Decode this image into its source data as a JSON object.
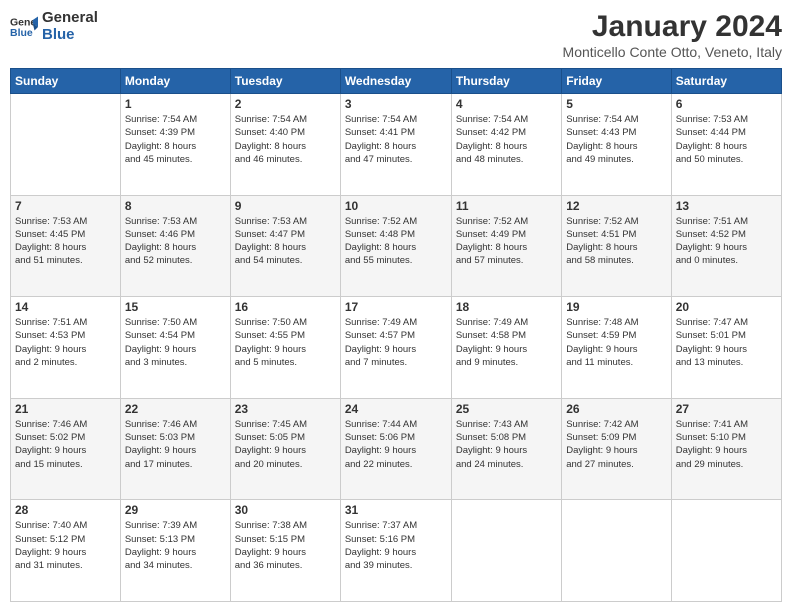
{
  "logo": {
    "line1": "General",
    "line2": "Blue"
  },
  "title": "January 2024",
  "subtitle": "Monticello Conte Otto, Veneto, Italy",
  "days_header": [
    "Sunday",
    "Monday",
    "Tuesday",
    "Wednesday",
    "Thursday",
    "Friday",
    "Saturday"
  ],
  "weeks": [
    [
      {
        "day": "",
        "info": ""
      },
      {
        "day": "1",
        "info": "Sunrise: 7:54 AM\nSunset: 4:39 PM\nDaylight: 8 hours\nand 45 minutes."
      },
      {
        "day": "2",
        "info": "Sunrise: 7:54 AM\nSunset: 4:40 PM\nDaylight: 8 hours\nand 46 minutes."
      },
      {
        "day": "3",
        "info": "Sunrise: 7:54 AM\nSunset: 4:41 PM\nDaylight: 8 hours\nand 47 minutes."
      },
      {
        "day": "4",
        "info": "Sunrise: 7:54 AM\nSunset: 4:42 PM\nDaylight: 8 hours\nand 48 minutes."
      },
      {
        "day": "5",
        "info": "Sunrise: 7:54 AM\nSunset: 4:43 PM\nDaylight: 8 hours\nand 49 minutes."
      },
      {
        "day": "6",
        "info": "Sunrise: 7:53 AM\nSunset: 4:44 PM\nDaylight: 8 hours\nand 50 minutes."
      }
    ],
    [
      {
        "day": "7",
        "info": "Sunrise: 7:53 AM\nSunset: 4:45 PM\nDaylight: 8 hours\nand 51 minutes."
      },
      {
        "day": "8",
        "info": "Sunrise: 7:53 AM\nSunset: 4:46 PM\nDaylight: 8 hours\nand 52 minutes."
      },
      {
        "day": "9",
        "info": "Sunrise: 7:53 AM\nSunset: 4:47 PM\nDaylight: 8 hours\nand 54 minutes."
      },
      {
        "day": "10",
        "info": "Sunrise: 7:52 AM\nSunset: 4:48 PM\nDaylight: 8 hours\nand 55 minutes."
      },
      {
        "day": "11",
        "info": "Sunrise: 7:52 AM\nSunset: 4:49 PM\nDaylight: 8 hours\nand 57 minutes."
      },
      {
        "day": "12",
        "info": "Sunrise: 7:52 AM\nSunset: 4:51 PM\nDaylight: 8 hours\nand 58 minutes."
      },
      {
        "day": "13",
        "info": "Sunrise: 7:51 AM\nSunset: 4:52 PM\nDaylight: 9 hours\nand 0 minutes."
      }
    ],
    [
      {
        "day": "14",
        "info": "Sunrise: 7:51 AM\nSunset: 4:53 PM\nDaylight: 9 hours\nand 2 minutes."
      },
      {
        "day": "15",
        "info": "Sunrise: 7:50 AM\nSunset: 4:54 PM\nDaylight: 9 hours\nand 3 minutes."
      },
      {
        "day": "16",
        "info": "Sunrise: 7:50 AM\nSunset: 4:55 PM\nDaylight: 9 hours\nand 5 minutes."
      },
      {
        "day": "17",
        "info": "Sunrise: 7:49 AM\nSunset: 4:57 PM\nDaylight: 9 hours\nand 7 minutes."
      },
      {
        "day": "18",
        "info": "Sunrise: 7:49 AM\nSunset: 4:58 PM\nDaylight: 9 hours\nand 9 minutes."
      },
      {
        "day": "19",
        "info": "Sunrise: 7:48 AM\nSunset: 4:59 PM\nDaylight: 9 hours\nand 11 minutes."
      },
      {
        "day": "20",
        "info": "Sunrise: 7:47 AM\nSunset: 5:01 PM\nDaylight: 9 hours\nand 13 minutes."
      }
    ],
    [
      {
        "day": "21",
        "info": "Sunrise: 7:46 AM\nSunset: 5:02 PM\nDaylight: 9 hours\nand 15 minutes."
      },
      {
        "day": "22",
        "info": "Sunrise: 7:46 AM\nSunset: 5:03 PM\nDaylight: 9 hours\nand 17 minutes."
      },
      {
        "day": "23",
        "info": "Sunrise: 7:45 AM\nSunset: 5:05 PM\nDaylight: 9 hours\nand 20 minutes."
      },
      {
        "day": "24",
        "info": "Sunrise: 7:44 AM\nSunset: 5:06 PM\nDaylight: 9 hours\nand 22 minutes."
      },
      {
        "day": "25",
        "info": "Sunrise: 7:43 AM\nSunset: 5:08 PM\nDaylight: 9 hours\nand 24 minutes."
      },
      {
        "day": "26",
        "info": "Sunrise: 7:42 AM\nSunset: 5:09 PM\nDaylight: 9 hours\nand 27 minutes."
      },
      {
        "day": "27",
        "info": "Sunrise: 7:41 AM\nSunset: 5:10 PM\nDaylight: 9 hours\nand 29 minutes."
      }
    ],
    [
      {
        "day": "28",
        "info": "Sunrise: 7:40 AM\nSunset: 5:12 PM\nDaylight: 9 hours\nand 31 minutes."
      },
      {
        "day": "29",
        "info": "Sunrise: 7:39 AM\nSunset: 5:13 PM\nDaylight: 9 hours\nand 34 minutes."
      },
      {
        "day": "30",
        "info": "Sunrise: 7:38 AM\nSunset: 5:15 PM\nDaylight: 9 hours\nand 36 minutes."
      },
      {
        "day": "31",
        "info": "Sunrise: 7:37 AM\nSunset: 5:16 PM\nDaylight: 9 hours\nand 39 minutes."
      },
      {
        "day": "",
        "info": ""
      },
      {
        "day": "",
        "info": ""
      },
      {
        "day": "",
        "info": ""
      }
    ]
  ]
}
